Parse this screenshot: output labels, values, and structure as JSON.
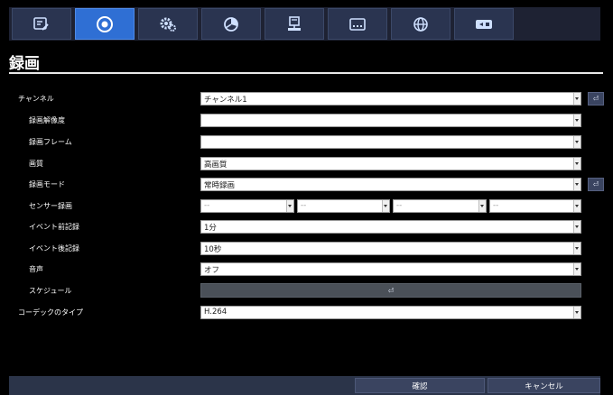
{
  "tabs": [
    {
      "icon": "display-settings-icon",
      "active": false
    },
    {
      "icon": "record-icon",
      "active": true
    },
    {
      "icon": "gear-icon",
      "active": false
    },
    {
      "icon": "pie-chart-icon",
      "active": false
    },
    {
      "icon": "network-icon",
      "active": false
    },
    {
      "icon": "device-icon",
      "active": false
    },
    {
      "icon": "globe-icon",
      "active": false
    },
    {
      "icon": "switch-icon",
      "active": false
    }
  ],
  "page_title": "録画",
  "rows": {
    "channel": {
      "label": "チャンネル",
      "value": "チャンネル1"
    },
    "resolution": {
      "label": "録画解像度",
      "value": ""
    },
    "framerate": {
      "label": "録画フレーム",
      "value": ""
    },
    "quality": {
      "label": "画質",
      "value": "高画質"
    },
    "mode": {
      "label": "録画モード",
      "value": "常時録画"
    },
    "sensor": {
      "label": "センサー録画",
      "values": [
        "--",
        "--",
        "--",
        "--"
      ]
    },
    "pre_record": {
      "label": "イベント前記録",
      "value": "1分"
    },
    "post_record": {
      "label": "イベント後記録",
      "value": "10秒"
    },
    "audio": {
      "label": "音声",
      "value": "オフ"
    },
    "schedule": {
      "label": "スケジュール"
    },
    "codec": {
      "label": "コーデックのタイプ",
      "value": "H.264"
    }
  },
  "footer": {
    "confirm": "確認",
    "cancel": "キャンセル"
  }
}
